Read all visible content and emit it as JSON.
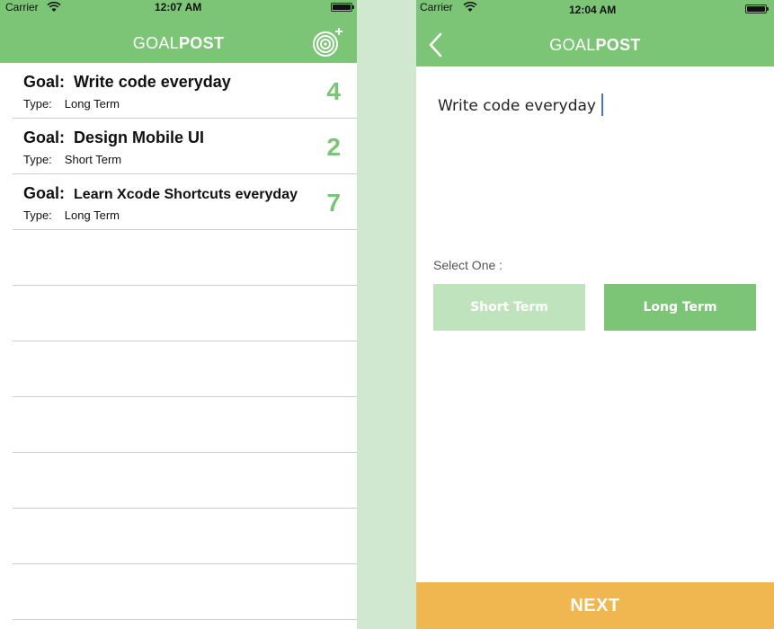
{
  "left_screen": {
    "status_bar": {
      "carrier": "Carrier",
      "time": "12:07 AM"
    },
    "nav": {
      "title_light": "GOAL",
      "title_bold": "POST",
      "add_icon": "target-plus-icon"
    },
    "goals": [
      {
        "prefix": "Goal:",
        "text": "Write code everyday",
        "type_prefix": "Type:",
        "type": "Long Term",
        "count": "4"
      },
      {
        "prefix": "Goal:",
        "text": "Design Mobile UI",
        "type_prefix": "Type:",
        "type": "Short Term",
        "count": "2"
      },
      {
        "prefix": "Goal:",
        "text": "Learn Xcode Shortcuts everyday",
        "type_prefix": "Type:",
        "type": "Long Term",
        "count": "7"
      }
    ]
  },
  "right_screen": {
    "status_bar": {
      "carrier": "Carrier",
      "time": "12:04 AM"
    },
    "nav": {
      "title_light": "GOAL",
      "title_bold": "POST",
      "back_icon": "chevron-left-icon"
    },
    "goal_input": {
      "value": "Write code everyday"
    },
    "select_label": "Select One :",
    "short_term_label": "Short Term",
    "long_term_label": "Long Term",
    "next_label": "NEXT"
  },
  "colors": {
    "green": "#7cc576",
    "light_green": "#bfe4bd",
    "orange": "#f0b650",
    "background": "#cfe8cf"
  }
}
